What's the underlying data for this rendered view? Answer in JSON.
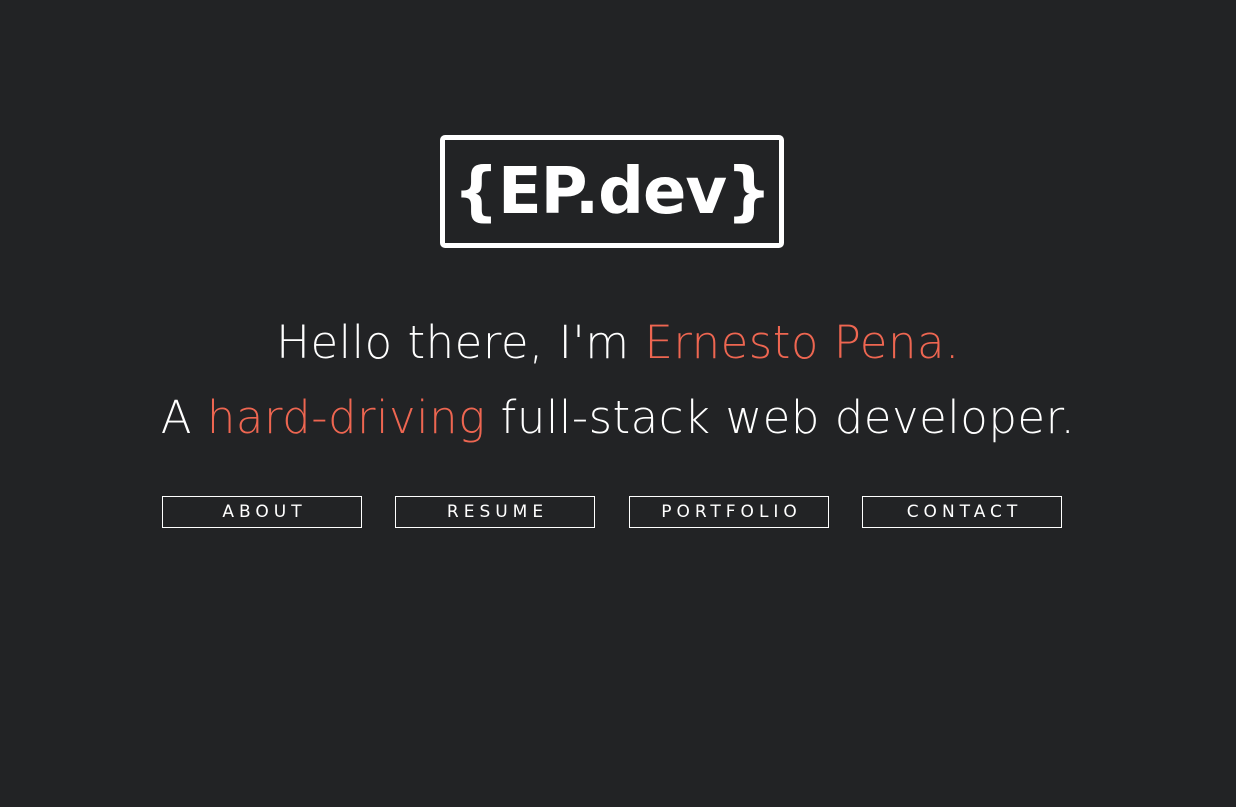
{
  "logo": {
    "text": "{EP.dev}"
  },
  "intro": {
    "line1_prefix": "Hello there, I'm ",
    "name": "Ernesto Pena.",
    "line2_prefix": "A ",
    "adjective": "hard-driving",
    "line2_suffix": " full-stack web developer."
  },
  "nav": {
    "items": [
      {
        "label": "ABOUT"
      },
      {
        "label": "RESUME"
      },
      {
        "label": "PORTFOLIO"
      },
      {
        "label": "CONTACT"
      }
    ]
  },
  "colors": {
    "background": "#222325",
    "text": "#ffffff",
    "accent": "#ee6651"
  }
}
